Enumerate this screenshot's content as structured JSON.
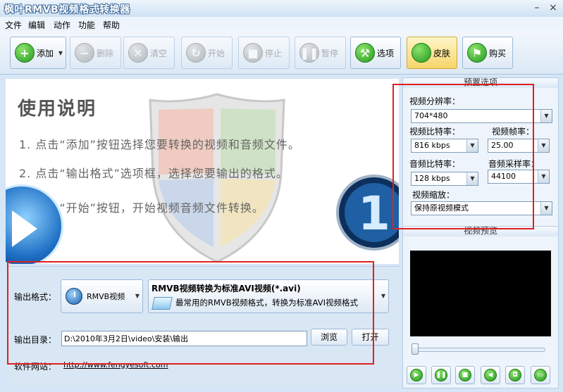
{
  "window": {
    "title": "枫叶RMVB视频格式转换器"
  },
  "menu": [
    "文件",
    "编辑",
    "动作",
    "功能",
    "帮助"
  ],
  "toolbar": {
    "add": "添加",
    "delete": "删除",
    "clear": "清空",
    "start": "开始",
    "stop": "停止",
    "pause": "暂停",
    "options": "选项",
    "skin": "皮肤",
    "buy": "购买"
  },
  "help": {
    "title": "使用说明",
    "lines": [
      "1. 点击“添加”按钮选择您要转换的视频和音频文件。",
      "2. 点击“输出格式”选项框，选择您要输出的格式。",
      "3. 点击“开始”按钮，开始视频音频文件转换。"
    ],
    "badge": "1"
  },
  "output": {
    "format_label": "输出格式：",
    "format_name": "RMVB视频",
    "format_title": "RMVB视频转换为标准AVI视频(*.avi)",
    "format_desc": "最常用的RMVB视频格式，转换为标准AVI视频格式",
    "dir_label": "输出目录：",
    "dir_value": "D:\\2010年3月2日\\video\\安装\\输出",
    "browse": "浏览",
    "open": "打开",
    "site_label": "软件网站：",
    "site_url": "http://www.fengyesoft.com"
  },
  "presets": {
    "header": "预置选项",
    "resolution_label": "视频分辨率：",
    "resolution": "704*480",
    "vbitrate_label": "视频比特率：",
    "vbitrate": "816 kbps",
    "framerate_label": "视频帧率：",
    "framerate": "25.00",
    "abitrate_label": "音频比特率：",
    "abitrate": "128 kbps",
    "samplerate_label": "音频采样率：",
    "samplerate": "44100",
    "scale_label": "视频缩放：",
    "scale": "保持原视频模式"
  },
  "preview": {
    "header": "视频预览"
  },
  "icons": {
    "add": "plus-icon",
    "delete": "minus-icon",
    "clear": "x-icon",
    "start": "refresh-icon",
    "stop": "stop-icon",
    "pause": "pause-icon",
    "options": "tools-icon",
    "skin": "apple-icon",
    "buy": "cart-icon"
  },
  "colors": {
    "accent": "#2f8f2a",
    "highlight": "#e02020",
    "panel": "#d6e6f6"
  }
}
